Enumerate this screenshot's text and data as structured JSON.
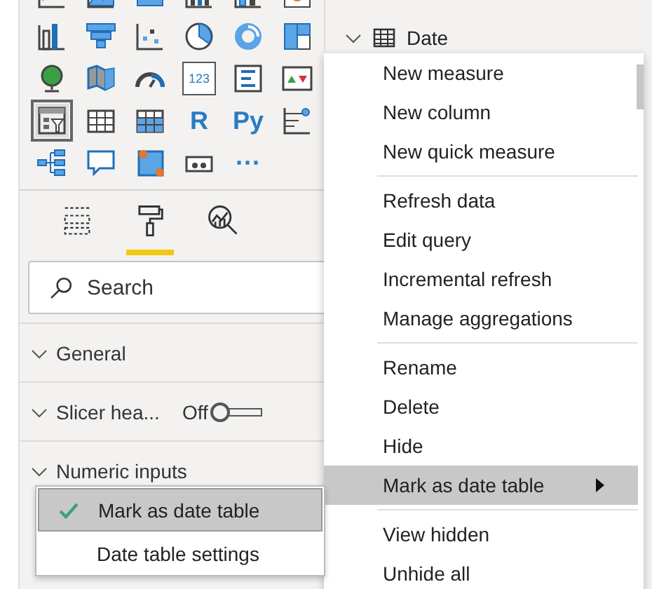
{
  "visuals": [
    {
      "selected": false
    },
    {
      "selected": false
    },
    {
      "selected": false
    },
    {
      "selected": false
    },
    {
      "selected": false
    },
    {
      "selected": false
    },
    {
      "selected": false
    },
    {
      "selected": false
    },
    {
      "selected": false
    },
    {
      "selected": false
    },
    {
      "selected": false
    },
    {
      "selected": false
    },
    {
      "selected": false
    },
    {
      "selected": false
    },
    {
      "selected": false
    },
    {
      "selected": false,
      "label": "123"
    },
    {
      "selected": false
    },
    {
      "selected": false
    },
    {
      "selected": true
    },
    {
      "selected": false
    },
    {
      "selected": false
    },
    {
      "selected": false,
      "label": "R"
    },
    {
      "selected": false,
      "label": "Py"
    },
    {
      "selected": false
    },
    {
      "selected": false
    },
    {
      "selected": false
    },
    {
      "selected": false
    },
    {
      "selected": false
    },
    {
      "selected": false,
      "label": "···"
    }
  ],
  "pane_tabs": [
    {
      "selected": false
    },
    {
      "selected": true
    },
    {
      "selected": false
    }
  ],
  "search": {
    "placeholder": "Search"
  },
  "sections": [
    {
      "title": "General"
    },
    {
      "title": "Slicer hea...",
      "toggle": {
        "label": "Off",
        "on": false
      }
    },
    {
      "title": "Numeric inputs"
    }
  ],
  "fields": {
    "table": "Date",
    "expanded": true
  },
  "context_menu": {
    "groups": [
      [
        {
          "label": "New measure",
          "highlighted": false,
          "submenu": false
        },
        {
          "label": "New column",
          "highlighted": false,
          "submenu": false
        },
        {
          "label": "New quick measure",
          "highlighted": false,
          "submenu": false
        }
      ],
      [
        {
          "label": "Refresh data",
          "highlighted": false,
          "submenu": false
        },
        {
          "label": "Edit query",
          "highlighted": false,
          "submenu": false
        },
        {
          "label": "Incremental refresh",
          "highlighted": false,
          "submenu": false
        },
        {
          "label": "Manage aggregations",
          "highlighted": false,
          "submenu": false
        }
      ],
      [
        {
          "label": "Rename",
          "highlighted": false,
          "submenu": false
        },
        {
          "label": "Delete",
          "highlighted": false,
          "submenu": false
        },
        {
          "label": "Hide",
          "highlighted": false,
          "submenu": false
        },
        {
          "label": "Mark as date table",
          "highlighted": true,
          "submenu": true
        }
      ],
      [
        {
          "label": "View hidden",
          "highlighted": false,
          "submenu": false
        },
        {
          "label": "Unhide all",
          "highlighted": false,
          "submenu": false
        }
      ]
    ]
  },
  "submenu": [
    {
      "label": "Mark as date table",
      "checked": true,
      "selected": true
    },
    {
      "label": "Date table settings",
      "checked": false,
      "selected": false
    }
  ]
}
